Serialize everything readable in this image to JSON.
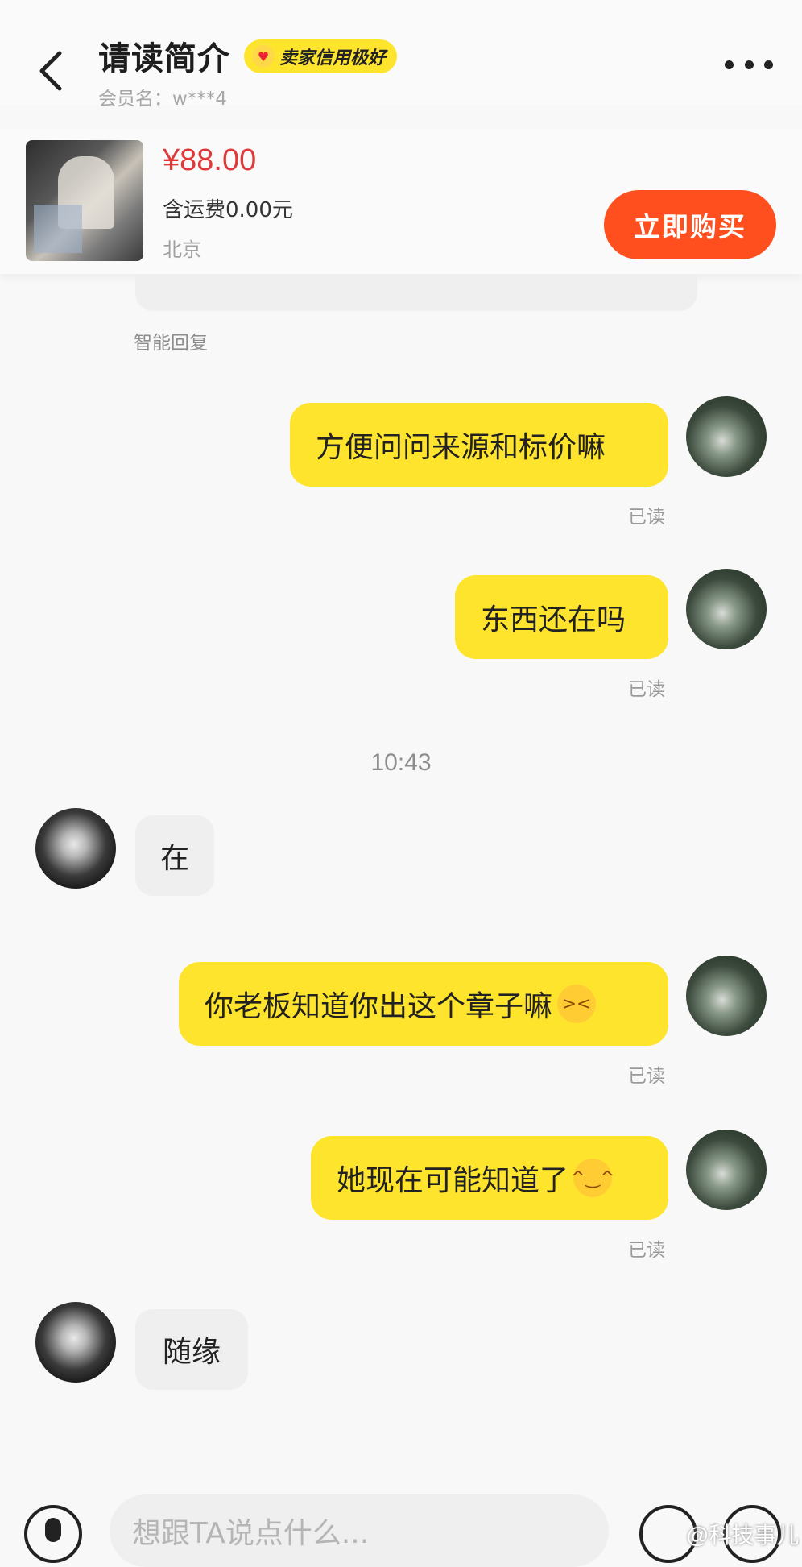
{
  "header": {
    "title": "请读简介",
    "badge": "卖家信用极好",
    "member": "会员名：w***4"
  },
  "product": {
    "price": "¥88.00",
    "shipping": "含运费0.00元",
    "location": "北京",
    "buy_label": "立即购买"
  },
  "chat": {
    "smart_reply": "智能回复",
    "read_label": "已读",
    "time": "10:43",
    "messages": [
      {
        "side": "right",
        "text": "方便问问来源和标价嘛"
      },
      {
        "side": "right",
        "text": "东西还在吗"
      },
      {
        "side": "left",
        "text": "在"
      },
      {
        "side": "right",
        "text": "你老板知道你出这个章子嘛",
        "emoji": "grinning-squint-emoji"
      },
      {
        "side": "right",
        "text": "她现在可能知道了",
        "emoji": "hugging-face-emoji"
      },
      {
        "side": "left",
        "text": "随缘"
      }
    ]
  },
  "input": {
    "placeholder": "想跟TA说点什么..."
  },
  "watermark": "@科技事儿",
  "colors": {
    "accent_yellow": "#ffe42e",
    "buy_orange": "#ff4f1f",
    "price_red": "#e0393a"
  },
  "icons": [
    "back-arrow-icon",
    "more-dots-icon",
    "mic-icon",
    "emoji-icon",
    "plus-icon"
  ]
}
